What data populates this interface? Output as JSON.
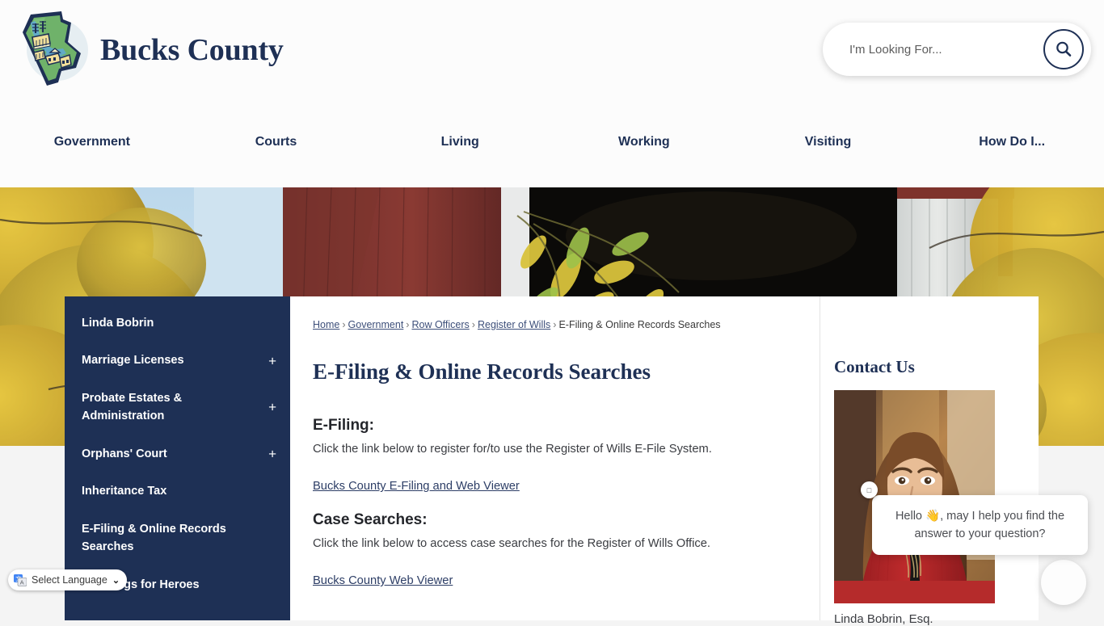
{
  "header": {
    "site_title": "Bucks County",
    "logo_icon": "bucks-county-map-logo"
  },
  "search": {
    "placeholder": "I'm Looking For...",
    "value": "",
    "icon": "search-icon"
  },
  "nav": {
    "items": [
      {
        "label": "Government"
      },
      {
        "label": "Courts"
      },
      {
        "label": "Living"
      },
      {
        "label": "Working"
      },
      {
        "label": "Visiting"
      },
      {
        "label": "How Do I..."
      }
    ]
  },
  "banner": {
    "description": "covered-bridge-autumn-photo"
  },
  "sidebar": {
    "items": [
      {
        "label": "Linda Bobrin",
        "expand": ""
      },
      {
        "label": "Marriage Licenses",
        "expand": "+"
      },
      {
        "label": "Probate Estates & Administration",
        "expand": "+"
      },
      {
        "label": "Orphans' Court",
        "expand": "+"
      },
      {
        "label": "Inheritance Tax",
        "expand": ""
      },
      {
        "label": "E-Filing & Online Records Searches",
        "expand": ""
      },
      {
        "label": "Weddings for Heroes",
        "expand": ""
      }
    ]
  },
  "breadcrumb": {
    "items": [
      {
        "label": "Home",
        "link": true
      },
      {
        "label": "Government",
        "link": true
      },
      {
        "label": "Row Officers",
        "link": true
      },
      {
        "label": "Register of Wills",
        "link": true
      },
      {
        "label": "E-Filing & Online Records Searches",
        "link": false
      }
    ],
    "separator": "›"
  },
  "main": {
    "page_title": "E-Filing & Online Records Searches",
    "sections": [
      {
        "heading": "E-Filing:",
        "body": "Click the link below to register for/to use the Register of Wills E-File System.",
        "link": "Bucks County E-Filing and Web Viewer"
      },
      {
        "heading": "Case Searches:",
        "body": "Click the link below to access case searches for the Register of Wills Office.",
        "link": "Bucks County Web Viewer"
      }
    ]
  },
  "right_rail": {
    "title": "Contact Us",
    "portrait_alt": "linda-bobrin-portrait",
    "caption": "Linda Bobrin, Esq."
  },
  "language_widget": {
    "label": "Select Language",
    "chevron": "❯",
    "icon": "google-translate-icon"
  },
  "chat": {
    "message": "Hello 👋, may I help you find the answer to your question?",
    "close_icon": "□",
    "launcher_icon": "chat-launcher"
  },
  "colors": {
    "navy": "#1e3055",
    "link": "#2d3e66",
    "page_bg": "#f4f4f4",
    "panel_bg": "#ffffff"
  }
}
